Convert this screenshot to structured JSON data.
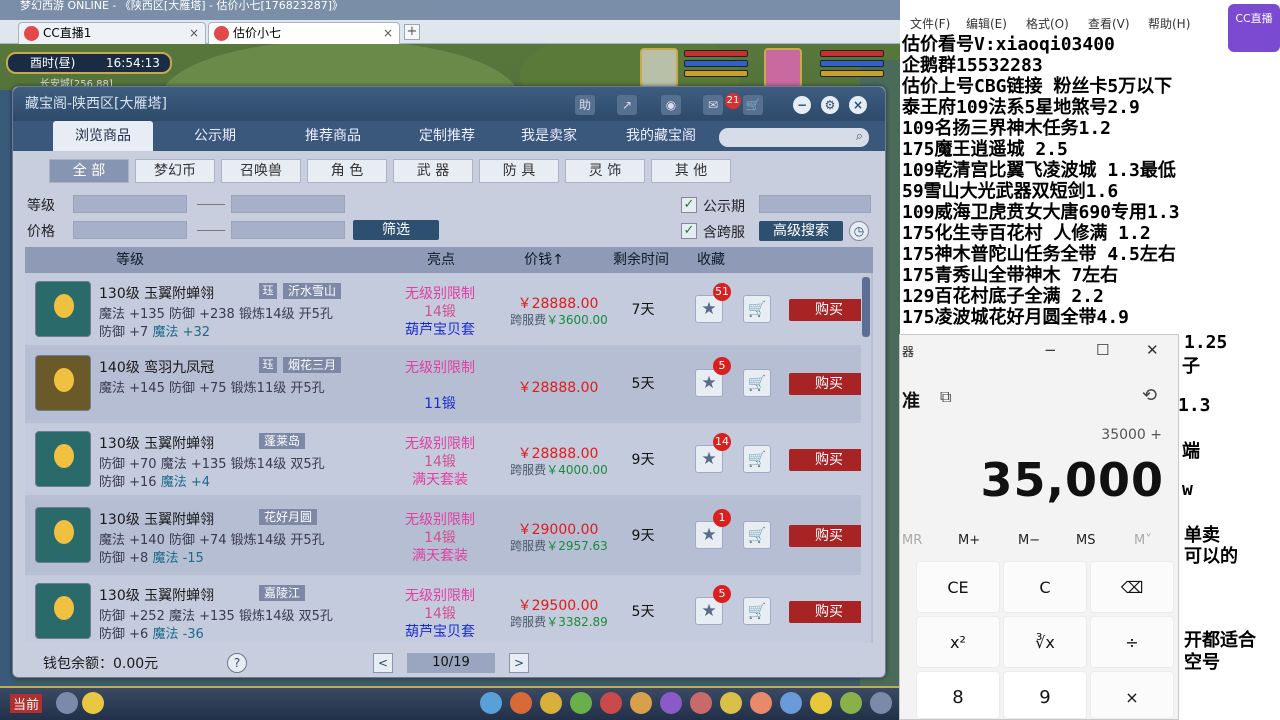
{
  "browser": {
    "top_text": "梦幻西游 ONLINE - 《陕西区[大雁塔]  - 估价小七[176823287]》",
    "tabs": [
      {
        "label": "CC直播1",
        "close": "×"
      },
      {
        "label": "估价小七",
        "close": "×"
      }
    ],
    "new_tab": "+"
  },
  "game_hud": {
    "period": "酉时(昼)",
    "clock": "16:54:13",
    "location": "长安城[256,88]"
  },
  "shop": {
    "title": "藏宝阁-陕西区[大雁塔]",
    "title_icons": [
      "助",
      "↗",
      "◉",
      "✉"
    ],
    "cart_count": "21",
    "win_buttons": [
      "−",
      "⚙",
      "×"
    ],
    "nav_tabs": [
      "浏览商品",
      "公示期",
      "推荐商品",
      "定制推荐",
      "我是卖家",
      "我的藏宝阁"
    ],
    "search_placeholder": "",
    "categories": [
      "全 部",
      "梦幻币",
      "召唤兽",
      "角 色",
      "武 器",
      "防 具",
      "灵 饰",
      "其 他"
    ],
    "filters": {
      "level_label": "等级",
      "price_label": "价格",
      "filter_button": "筛选",
      "public_period_label": "公示期",
      "cross_server_label": "含跨服",
      "advanced_search": "高级搜索",
      "check": "✓"
    },
    "columns": {
      "level": "等级",
      "highlights": "亮点",
      "price": "价钱↑",
      "remaining": "剩余时间",
      "favorite": "收藏"
    },
    "lock_tag": "珏",
    "buy_label": "购买",
    "star": "★",
    "cart": "🛒",
    "items": [
      {
        "name": "130级  玉翼附蝉翎",
        "locked": true,
        "server": "沂水雪山",
        "stat1": "魔法 +135 防御 +238 锻炼14级 开5孔",
        "stat2a": "防御 +7",
        "stat2b": "魔法 +32",
        "hl1": "无级别限制",
        "hl2": "14锻",
        "hl3": "葫芦宝贝套",
        "price": "￥28888.00",
        "cross_label": "跨服费",
        "cross_fee": "￥3600.00",
        "remaining": "7天",
        "fav": "51"
      },
      {
        "name": "140级  鸾羽九凤冠",
        "locked": true,
        "server": "烟花三月",
        "stat1": "魔法 +145 防御 +75 锻炼11级 开5孔",
        "stat2a": "",
        "stat2b": "",
        "hl1": "无级别限制",
        "hl2": "11锻",
        "hl3": "",
        "price": "￥28888.00",
        "cross_label": "",
        "cross_fee": "",
        "remaining": "5天",
        "fav": "5"
      },
      {
        "name": "130级  玉翼附蝉翎",
        "locked": false,
        "server": "蓬莱岛",
        "stat1": "防御 +70 魔法 +135 锻炼14级 双5孔",
        "stat2a": "防御 +16",
        "stat2b": "魔法 +4",
        "hl1": "无级别限制",
        "hl2": "14锻",
        "hl3": "满天套装",
        "price": "￥28888.00",
        "cross_label": "跨服费",
        "cross_fee": "￥4000.00",
        "remaining": "9天",
        "fav": "14"
      },
      {
        "name": "130级  玉翼附蝉翎",
        "locked": false,
        "server": "花好月圆",
        "stat1": "魔法 +140 防御 +74 锻炼14级 开5孔",
        "stat2a": "防御 +8",
        "stat2b": "魔法 -15",
        "hl1": "无级别限制",
        "hl2": "14锻",
        "hl3": "满天套装",
        "price": "￥29000.00",
        "cross_label": "跨服费",
        "cross_fee": "￥2957.63",
        "remaining": "9天",
        "fav": "1"
      },
      {
        "name": "130级  玉翼附蝉翎",
        "locked": false,
        "server": "嘉陵江",
        "stat1": "防御 +252 魔法 +135 锻炼14级 双5孔",
        "stat2a": "防御 +6",
        "stat2b": "魔法 -36",
        "hl1": "无级别限制",
        "hl2": "14锻",
        "hl3": "葫芦宝贝套",
        "price": "￥29500.00",
        "cross_label": "跨服费",
        "cross_fee": "￥3382.89",
        "remaining": "5天",
        "fav": "5"
      }
    ],
    "wallet": "钱包余额：0.00元",
    "help": "?",
    "page": "10/19",
    "prev": "<",
    "next": ">"
  },
  "hotbar": {
    "label": "当前"
  },
  "notepad": {
    "menu": [
      "文件(F)",
      "编辑(E)",
      "格式(O)",
      "查看(V)",
      "帮助(H)"
    ],
    "lines": [
      "估价看号V:xiaoqi03400",
      "企鹅群15532283",
      "估价上号CBG链接   粉丝卡5万以下",
      "泰王府109法系5星地煞号2.9",
      "109名扬三界神木任务1.2",
      "175魔王逍遥城 2.5",
      "109乾清宫比翼飞凌波城 1.3最低",
      "59雪山大光武器双短剑1.6",
      "109威海卫虎贲女大唐690专用1.3",
      "175化生寺百花村 人修满 1.2",
      "175神木普陀山任务全带 4.5左右",
      "175青秀山全带神木  7左右",
      "129百花村底子全满 2.2",
      "175凌波城花好月圆全带4.9"
    ],
    "fragments": [
      "1.25",
      "子",
      "1.3",
      "端",
      "w",
      "单卖",
      "可以的",
      "开都适合",
      "空号"
    ]
  },
  "cc_logo": "CC直播",
  "calculator": {
    "title": "器",
    "min": "−",
    "max": "☐",
    "close": "✕",
    "mode": "准",
    "keep_on_top": "⧉",
    "history": "⟲",
    "expression": "35000 +",
    "display": "35,000",
    "memory": [
      "MR",
      "M+",
      "M−",
      "MS",
      "M˅"
    ],
    "keys": [
      "CE",
      "C",
      "⌫",
      "x²",
      "∛x",
      "÷",
      "8",
      "9",
      "×"
    ]
  }
}
